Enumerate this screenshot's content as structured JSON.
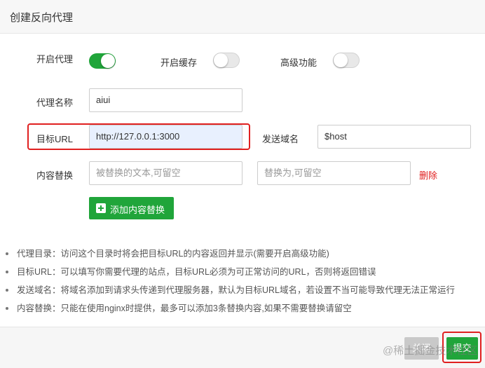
{
  "dialog": {
    "title": "创建反向代理"
  },
  "toggles": {
    "enable_proxy": {
      "label": "开启代理",
      "state": "on"
    },
    "enable_cache": {
      "label": "开启缓存",
      "state": "off"
    },
    "advanced": {
      "label": "高级功能",
      "state": "off"
    }
  },
  "form": {
    "proxy_name": {
      "label": "代理名称",
      "value": "aiui"
    },
    "target_url": {
      "label": "目标URL",
      "value": "http://127.0.0.1:3000"
    },
    "send_domain": {
      "label": "发送域名",
      "value": "$host"
    },
    "content_replace": {
      "label": "内容替换",
      "replaced_placeholder": "被替换的文本,可留空",
      "replace_with_placeholder": "替换为,可留空",
      "delete_label": "删除"
    },
    "add_replace_button": "添加内容替换"
  },
  "tips": [
    "代理目录：访问这个目录时将会把目标URL的内容返回并显示(需要开启高级功能)",
    "目标URL：可以填写你需要代理的站点，目标URL必须为可正常访问的URL，否则将返回错误",
    "发送域名：将域名添加到请求头传递到代理服务器，默认为目标URL域名，若设置不当可能导致代理无法正常运行",
    "内容替换：只能在使用nginx时提供，最多可以添加3条替换内容,如果不需要替换请留空"
  ],
  "footer": {
    "cancel_label": "关闭",
    "submit_label": "提交"
  },
  "watermark": "@稀土掘金技术社区",
  "colors": {
    "accent": "#20a53a",
    "highlight_box": "#e02020",
    "delete": "#e02020"
  }
}
